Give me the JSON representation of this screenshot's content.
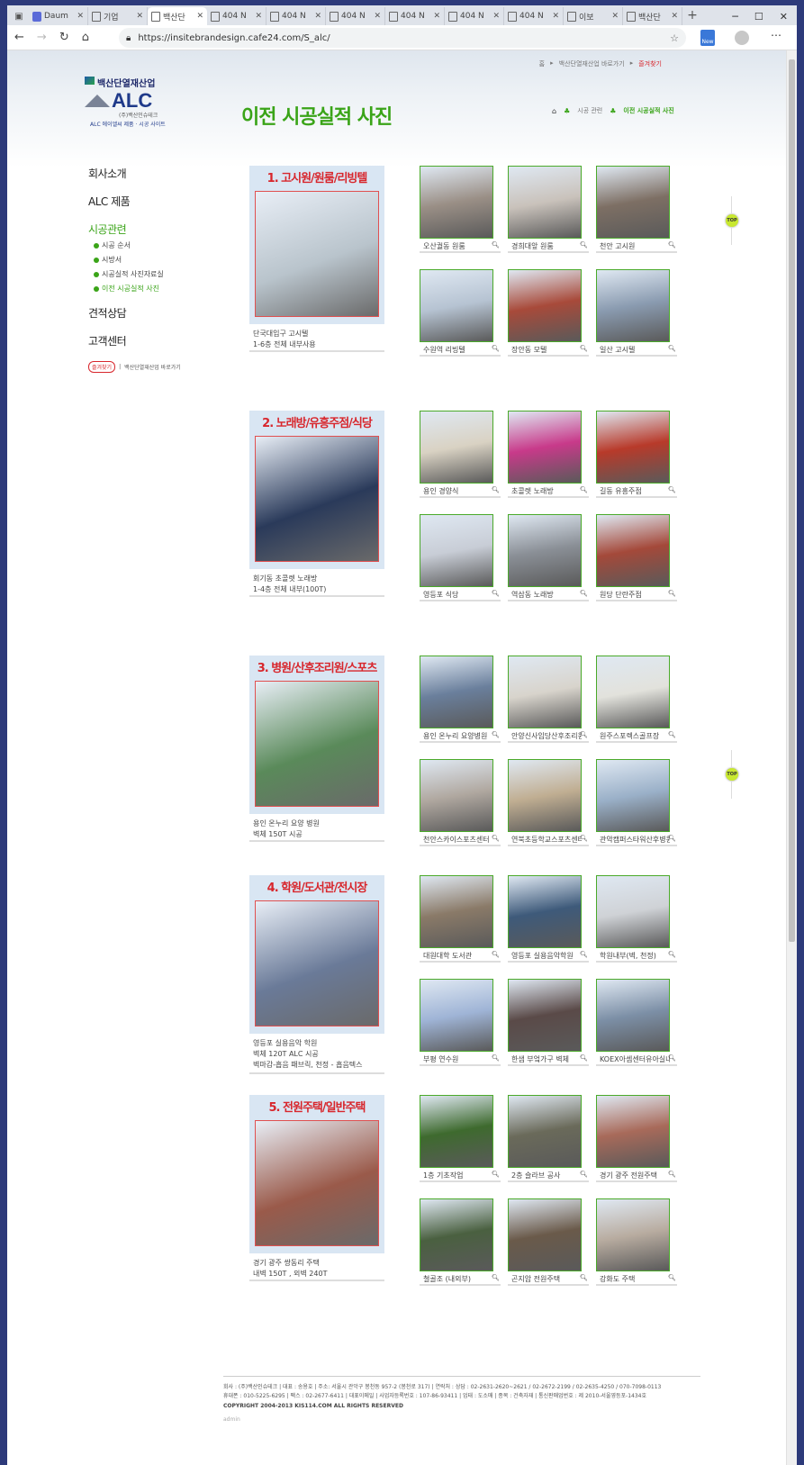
{
  "browser": {
    "tabs": [
      {
        "label": "Daum"
      },
      {
        "label": "기업"
      },
      {
        "label": "백산단"
      },
      {
        "label": "404 N"
      },
      {
        "label": "404 N"
      },
      {
        "label": "404 N"
      },
      {
        "label": "404 N"
      },
      {
        "label": "404 N"
      },
      {
        "label": "404 N"
      },
      {
        "label": "이보"
      },
      {
        "label": "백산단"
      }
    ],
    "url": "https://insitebrandesign.cafe24.com/S_alc/",
    "new_badge": "New"
  },
  "header": {
    "top_links": [
      "홈",
      "백산단열재산업 바로가기",
      "즐겨찾기"
    ],
    "logo_company": "백산단열재산업",
    "logo_mark": "ALC",
    "logo_sub1": "(주)백산인슈테크",
    "logo_sub2": "ALC 에이엘씨 제품 · 시공 사이트"
  },
  "page_title": "이전 시공실적 사진",
  "breadcrumb": {
    "level1": "시공 관련",
    "level2": "이전 시공실적 사진"
  },
  "lnb": {
    "menu": [
      "회사소개",
      "ALC 제품",
      "시공관련",
      "견적상담",
      "고객센터"
    ],
    "sub": [
      "시공 순서",
      "시방서",
      "시공실적 사진자료실",
      "이전 시공실적 사진"
    ],
    "fav_label": "즐겨찾기",
    "fav_link": "백산단열재산업 바로가기"
  },
  "top_label": "TOP",
  "sections": [
    {
      "title": "1. 고시원/원룸/리빙텔",
      "caption1": "단국대입구 고시텔",
      "caption2": "1-6층 전체 내부사용",
      "caption3": "",
      "thumbs": [
        "오산궐동 원룸",
        "경희대앞 원룸",
        "천안 고시원",
        "수원역 리빙텔",
        "장안동 모텔",
        "일산 고시텔"
      ]
    },
    {
      "title": "2. 노래방/유흥주점/식당",
      "caption1": "회기동 초콜렛 노래방",
      "caption2": "1-4층 전체 내부(100T)",
      "caption3": "",
      "thumbs": [
        "용인 경양식",
        "초콜렛 노래방",
        "길동 유흥주점",
        "영등포 식당",
        "역삼동 노래방",
        "원당 단란주점"
      ]
    },
    {
      "title": "3. 병원/산후조리원/스포츠센터",
      "caption1": "용인 온누리 요양 병원",
      "caption2": "벽체 150T 시공",
      "caption3": "",
      "thumbs": [
        "용인 온누리 요양병원",
        "안양신사임당산후조리원",
        "원주스포렉스골프장",
        "천안스카이스포츠센터",
        "연북초등학교스포츠센터",
        "관악캠퍼스타워산후병원"
      ]
    },
    {
      "title": "4. 학원/도서관/전시장",
      "caption1": "영등포 실용음악 학원",
      "caption2": "벽체 120T ALC 시공",
      "caption3": "벽마감-흡음 패브릭, 천정 - 흡음텍스",
      "thumbs": [
        "대원대학 도서관",
        "영등포 실용음악학원",
        "학원내부(벽, 천정)",
        "부평 연수원",
        "한샘 부엌가구 벽체",
        "KOEX아셈센터유아실내부"
      ]
    },
    {
      "title": "5. 전원주택/일반주택",
      "caption1": "경기 광주 쌍동리 주택",
      "caption2": "내벽 150T , 외벽 240T",
      "caption3": "",
      "thumbs": [
        "1층 기초작업",
        "2층 슬라브 공사",
        "경기 광주 전원주택",
        "철골조 (내외부)",
        "곤지암 전원주택",
        "강화도 주택"
      ]
    }
  ],
  "footer": {
    "line1": "회사 : (주)백산인슈테크  |  대표 : 송용호  |  주소: 서울시 관악구 봉천동 957-2 (봉천로 317)  |  연락처 : 상담 : 02-2631-2620~2621  /  02-2672-2199  /  02-2635-4250  /  070-7098-0113",
    "line2": "휴대폰 : 010-5225-6295  |  팩스 : 02-2677-6411  |  대표이메일  |  사업자등록번호 : 107-86-93411  |  업태 : 도소매  |  종목 : 건축자재  |  통신판매업번호 : 제 2010-서울영등포-1434호",
    "copyright": "COPYRIGHT  2004-2013 KIS114.COM ALL RIGHTS RESERVED",
    "admin": "admin"
  },
  "colors": {
    "accent_green": "#3aa418",
    "accent_red": "#d8262c",
    "panel_blue": "#d9e6f3"
  }
}
